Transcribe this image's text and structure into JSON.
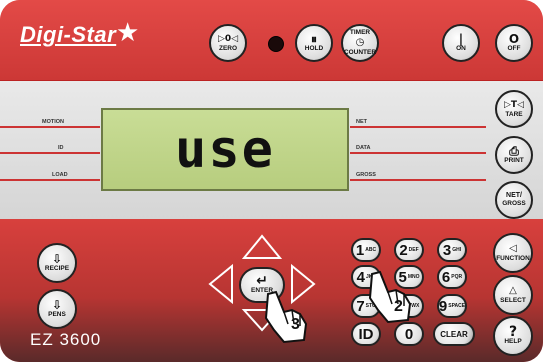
{
  "brand": "Digi-Star",
  "model": "EZ 3600",
  "display": {
    "text": "use"
  },
  "indicators": {
    "left": [
      "MOTION",
      "ID",
      "LOAD"
    ],
    "right": [
      "NET",
      "DATA",
      "GROSS"
    ]
  },
  "top_buttons": {
    "zero": {
      "glyph": "▷0◁",
      "label": "ZERO"
    },
    "hold": {
      "glyph": "⏸",
      "label": "HOLD"
    },
    "timer": {
      "glyph": "TIMER",
      "label": "COUNTER"
    },
    "on": {
      "glyph": "|",
      "label": "ON"
    },
    "off": {
      "glyph": "O",
      "label": "OFF"
    }
  },
  "side_buttons": {
    "tare": {
      "glyph": "▷T◁",
      "label": "TARE"
    },
    "print": {
      "glyph": "⎙",
      "label": "PRINT"
    },
    "netgross": {
      "glyph": "NET/",
      "label": "GROSS"
    }
  },
  "left_buttons": {
    "recipe": {
      "glyph": "⇩",
      "label": "RECIPE"
    },
    "pens": {
      "glyph": "⇩",
      "label": "PENS"
    }
  },
  "right_buttons": {
    "function": {
      "glyph": "◁",
      "label": "FUNCTION"
    },
    "select": {
      "glyph": "△",
      "label": "SELECT"
    },
    "help": {
      "glyph": "?",
      "label": "HELP"
    }
  },
  "keypad": [
    {
      "num": "1",
      "sub": "ABC"
    },
    {
      "num": "2",
      "sub": "DEF"
    },
    {
      "num": "3",
      "sub": "GHI"
    },
    {
      "num": "4",
      "sub": "JKL"
    },
    {
      "num": "5",
      "sub": "MNO"
    },
    {
      "num": "6",
      "sub": "PQR"
    },
    {
      "num": "7",
      "sub": "STU"
    },
    {
      "num": "8",
      "sub": "VWX"
    },
    {
      "num": "9",
      "sub": "SPACE"
    },
    {
      "num": "ID",
      "sub": ""
    },
    {
      "num": "0",
      "sub": ""
    },
    {
      "num": "CLEAR",
      "sub": ""
    }
  ],
  "enter_label": "ENTER",
  "callouts": [
    "3",
    "2"
  ],
  "colors": {
    "panel": "#d23d3b",
    "lcd": "#c2d78c",
    "accent": "#ffffff"
  }
}
